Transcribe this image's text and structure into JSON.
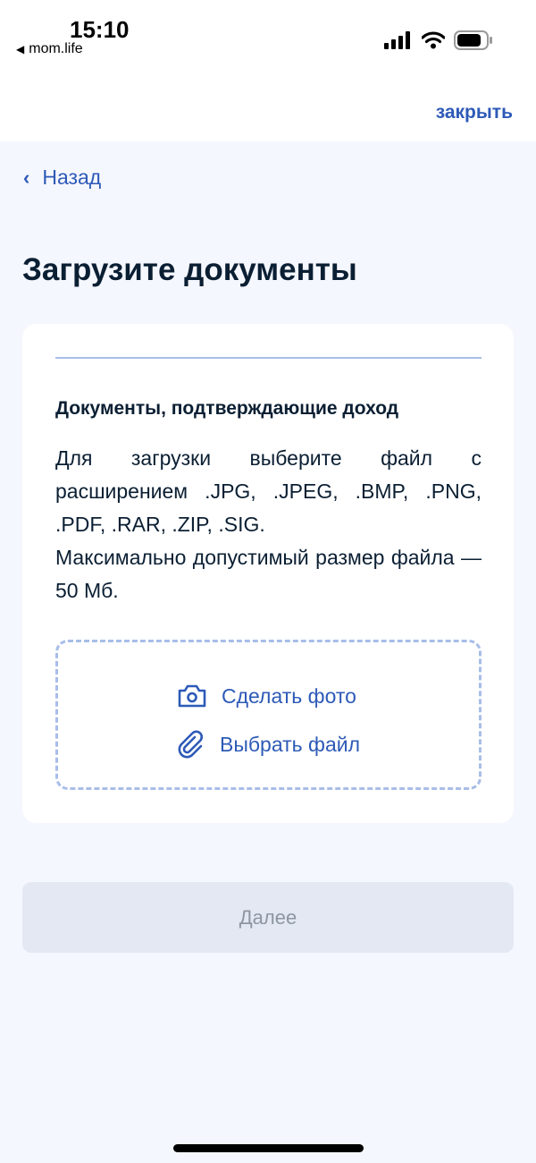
{
  "status_bar": {
    "time": "15:10",
    "back_app": "mom.life",
    "icons": [
      "signal-icon",
      "wifi-icon",
      "battery-icon"
    ]
  },
  "header": {
    "close_label": "закрыть"
  },
  "nav": {
    "back_label": "Назад"
  },
  "page": {
    "title": "Загрузите документы"
  },
  "card": {
    "heading": "Документы, подтверждающие доход",
    "desc_line1": "Для загрузки выберите файл с расширением .JPG, .JPEG, .BMP, .PNG, .PDF, .RAR, .ZIP, .SIG.",
    "desc_line2": "Максимально допустимый размер файла — 50 Мб.",
    "take_photo_label": "Сделать фото",
    "choose_file_label": "Выбрать файл"
  },
  "footer": {
    "next_label": "Далее"
  },
  "colors": {
    "accent": "#2d5ab7",
    "background": "#f5f7fe",
    "disabled_button": "#e3e8f2",
    "dashed_border": "#a8bde9"
  }
}
